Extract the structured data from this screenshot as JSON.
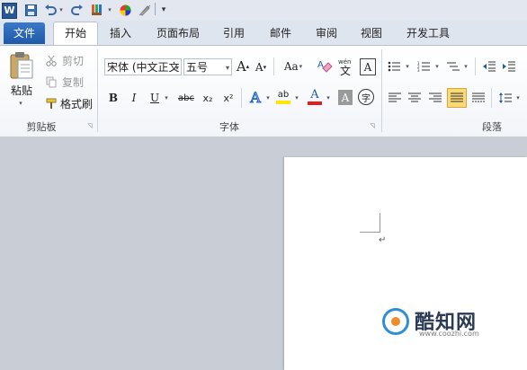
{
  "app": {
    "logo_letter": "W"
  },
  "qat": {
    "customize_arrow": "▾"
  },
  "tabs": [
    {
      "label": "文件"
    },
    {
      "label": "开始"
    },
    {
      "label": "插入"
    },
    {
      "label": "页面布局"
    },
    {
      "label": "引用"
    },
    {
      "label": "邮件"
    },
    {
      "label": "审阅"
    },
    {
      "label": "视图"
    },
    {
      "label": "开发工具"
    }
  ],
  "clipboard": {
    "paste_label": "粘贴",
    "cut_label": "剪切",
    "copy_label": "复制",
    "format_painter_label": "格式刷",
    "group_label": "剪贴板"
  },
  "font": {
    "font_name": "宋体 (中文正文",
    "font_size": "五号",
    "grow_label": "A",
    "shrink_label": "A",
    "change_case_label": "Aa",
    "bold": "B",
    "italic": "I",
    "underline": "U",
    "strikethrough": "abc",
    "subscript": "x₂",
    "superscript": "x²",
    "text_effect": "A",
    "highlight": "ab",
    "font_color": "A",
    "char_shading": "A",
    "enclose_char": "字",
    "phonetic_label": "wén",
    "border_label": "A",
    "group_label": "字体"
  },
  "paragraph": {
    "group_label": "段落"
  },
  "document": {
    "paragraph_mark": "↵"
  },
  "watermark": {
    "name": "酷知网",
    "url": "www.coozhi.com"
  },
  "colors": {
    "file_tab": "#2b6cc4",
    "font_color_bar": "#e02020",
    "highlight_bar": "#ffe600",
    "accent": "#2b5797"
  }
}
